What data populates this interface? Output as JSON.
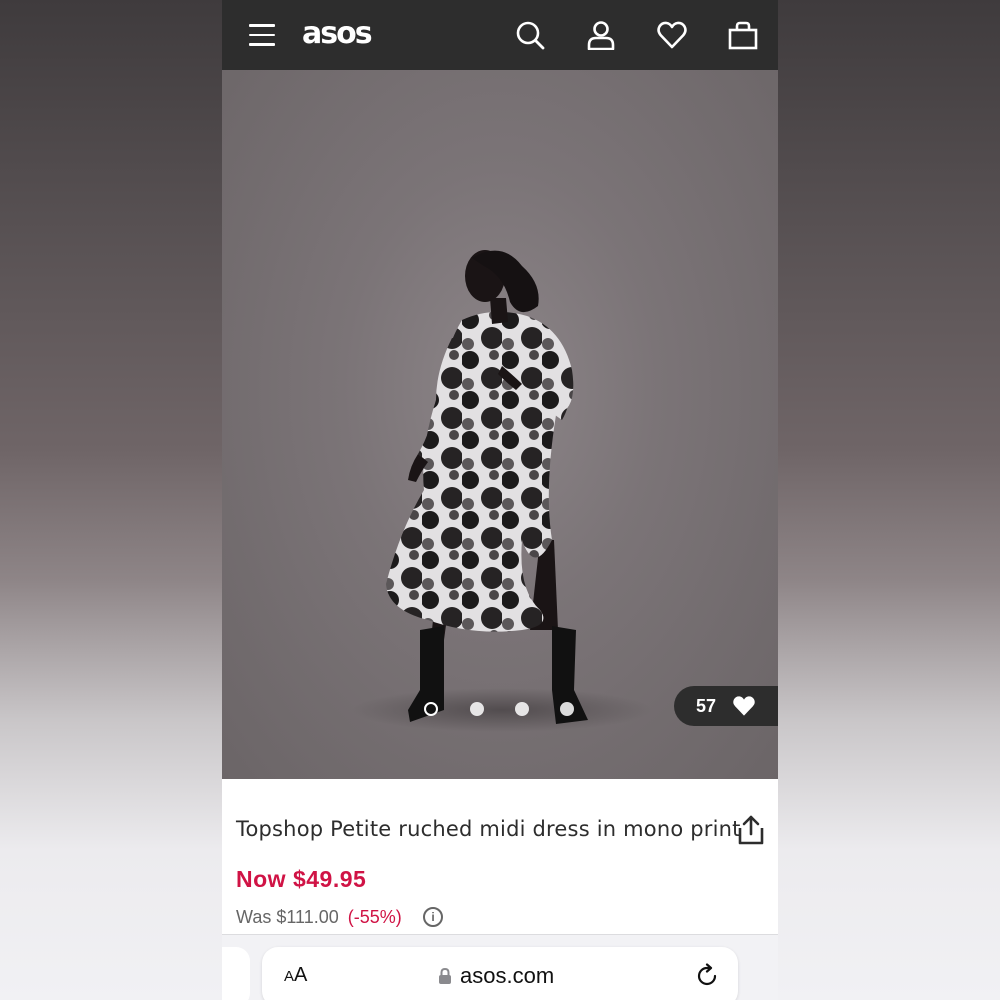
{
  "header": {
    "logo": "asos",
    "icons": [
      "menu-icon",
      "search-icon",
      "account-icon",
      "heart-icon",
      "bag-icon"
    ],
    "background": "#2d2d2d"
  },
  "gallery": {
    "image_count": 4,
    "active_index": 0,
    "likes": "57"
  },
  "product": {
    "title": "Topshop Petite ruched midi dress in mono print",
    "now_price": "Now $49.95",
    "was_price": "Was $111.00",
    "discount": "(-55%)",
    "price_color": "#d01345"
  },
  "browser": {
    "text_size_label_small": "A",
    "text_size_label_large": "A",
    "url": "asos.com"
  }
}
